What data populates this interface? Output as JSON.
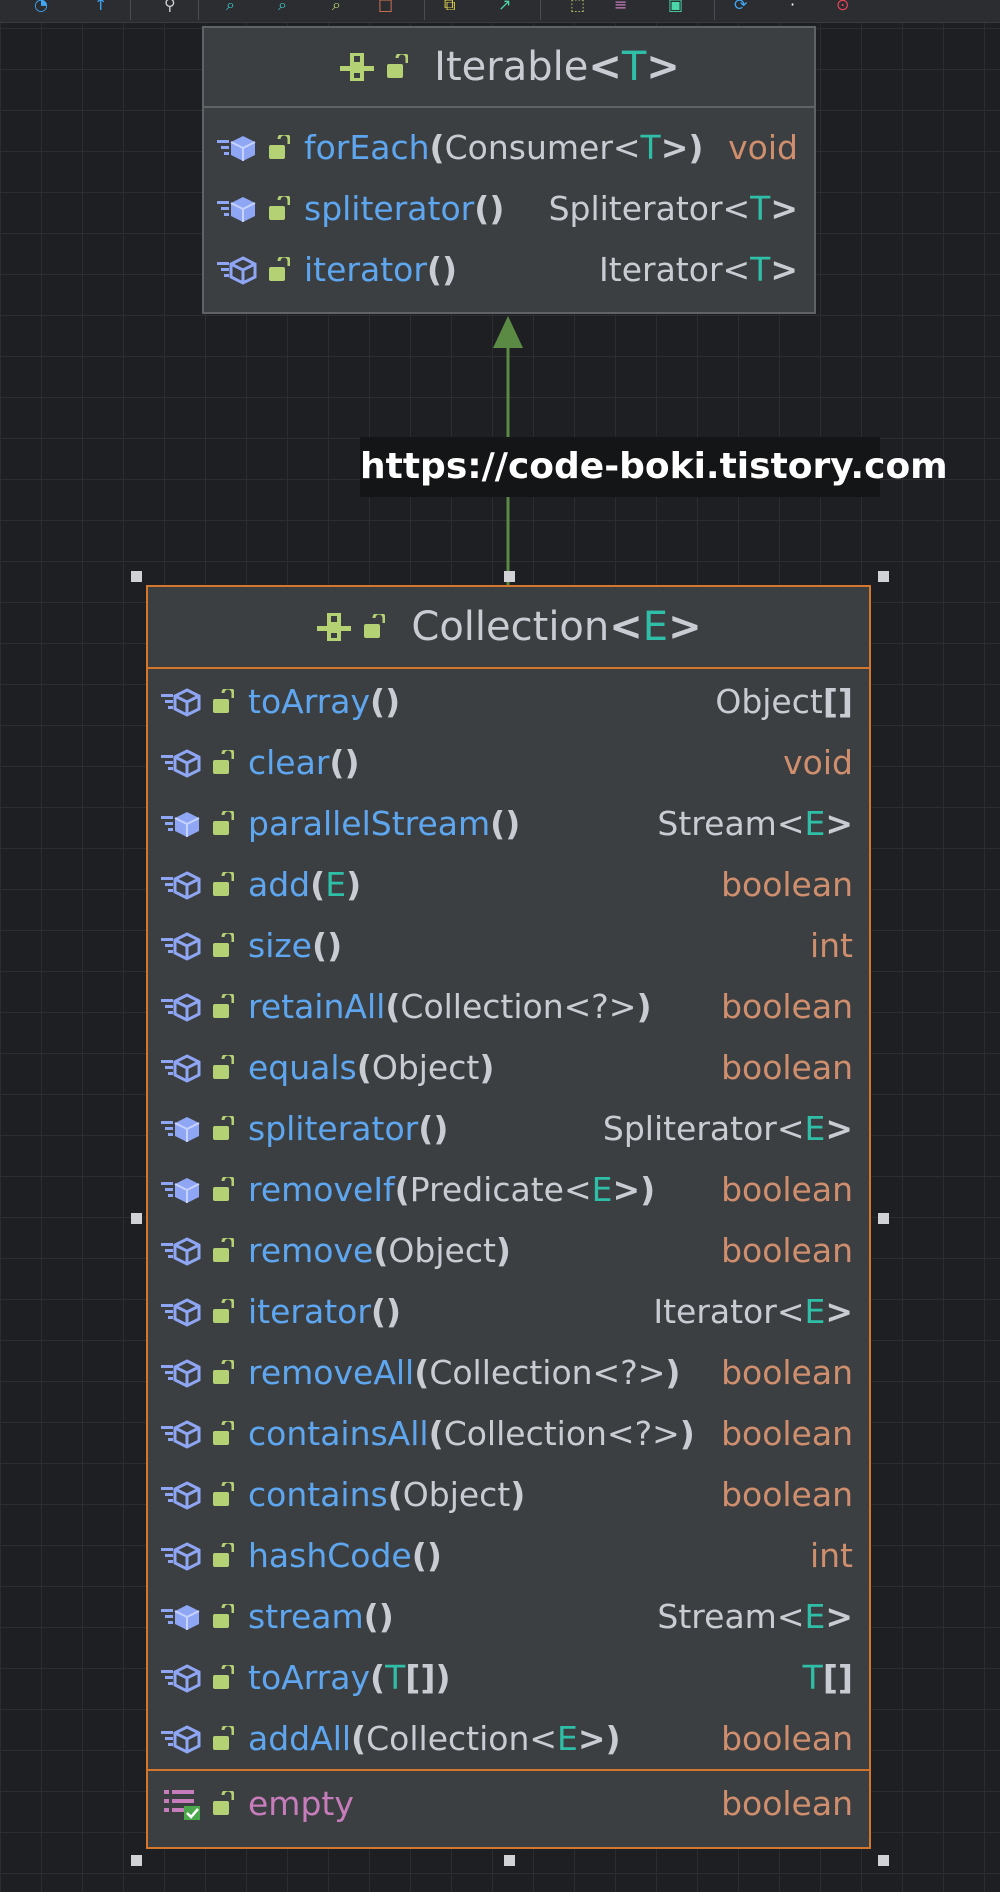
{
  "watermark": "https://code-boki.tistory.com",
  "toolbar": {
    "icons": [
      "refresh-icon",
      "pointer-icon",
      "layout-icon",
      "zoom-in-icon",
      "zoom-out-icon",
      "zoom-fit-icon",
      "export-icon",
      "copy-icon",
      "arrow-icon",
      "class-icon",
      "field-icon",
      "frame-icon",
      "sync-icon",
      "more-icon",
      "info-icon"
    ]
  },
  "colors": {
    "method_name": "#5ea7f0",
    "field_name": "#c77dbb",
    "keyword_type": "#cf8e6d",
    "type_param": "#2fbfa8",
    "plain_text": "#c9cdd3",
    "selection_border": "#d4762c",
    "inherit_arrow": "#5a8a44"
  },
  "iterable": {
    "name": "Iterable",
    "type_param": "T",
    "members": [
      {
        "name": "forEach",
        "params_pre": "Consumer<",
        "params_tp": "T",
        "params_post": ">",
        "ret_type": "",
        "ret_tp": "",
        "ret_post": "",
        "ret_kw": "void",
        "abstract": false
      },
      {
        "name": "spliterator",
        "params_pre": "",
        "params_tp": "",
        "params_post": "",
        "ret_type": "Spliterator<",
        "ret_tp": "T",
        "ret_post": ">",
        "ret_kw": "",
        "abstract": false
      },
      {
        "name": "iterator",
        "params_pre": "",
        "params_tp": "",
        "params_post": "",
        "ret_type": "Iterator<",
        "ret_tp": "T",
        "ret_post": ">",
        "ret_kw": "",
        "abstract": true
      }
    ]
  },
  "collection": {
    "name": "Collection",
    "type_param": "E",
    "members": [
      {
        "name": "toArray",
        "params_pre": "",
        "params_tp": "",
        "params_post": "",
        "ret_type": "Object",
        "ret_tp": "",
        "ret_post": "[]",
        "ret_kw": "",
        "abstract": true
      },
      {
        "name": "clear",
        "params_pre": "",
        "params_tp": "",
        "params_post": "",
        "ret_type": "",
        "ret_tp": "",
        "ret_post": "",
        "ret_kw": "void",
        "abstract": true
      },
      {
        "name": "parallelStream",
        "params_pre": "",
        "params_tp": "",
        "params_post": "",
        "ret_type": "Stream<",
        "ret_tp": "E",
        "ret_post": ">",
        "ret_kw": "",
        "abstract": false
      },
      {
        "name": "add",
        "params_pre": "",
        "params_tp": "E",
        "params_post": "",
        "ret_type": "",
        "ret_tp": "",
        "ret_post": "",
        "ret_kw": "boolean",
        "abstract": true
      },
      {
        "name": "size",
        "params_pre": "",
        "params_tp": "",
        "params_post": "",
        "ret_type": "",
        "ret_tp": "",
        "ret_post": "",
        "ret_kw": "int",
        "abstract": true
      },
      {
        "name": "retainAll",
        "params_pre": "Collection<?>",
        "params_tp": "",
        "params_post": "",
        "ret_type": "",
        "ret_tp": "",
        "ret_post": "",
        "ret_kw": "boolean",
        "abstract": true
      },
      {
        "name": "equals",
        "params_pre": "Object",
        "params_tp": "",
        "params_post": "",
        "ret_type": "",
        "ret_tp": "",
        "ret_post": "",
        "ret_kw": "boolean",
        "abstract": true
      },
      {
        "name": "spliterator",
        "params_pre": "",
        "params_tp": "",
        "params_post": "",
        "ret_type": "Spliterator<",
        "ret_tp": "E",
        "ret_post": ">",
        "ret_kw": "",
        "abstract": false
      },
      {
        "name": "removeIf",
        "params_pre": "Predicate<",
        "params_tp": "E",
        "params_post": ">",
        "ret_type": "",
        "ret_tp": "",
        "ret_post": "",
        "ret_kw": "boolean",
        "abstract": false
      },
      {
        "name": "remove",
        "params_pre": "Object",
        "params_tp": "",
        "params_post": "",
        "ret_type": "",
        "ret_tp": "",
        "ret_post": "",
        "ret_kw": "boolean",
        "abstract": true
      },
      {
        "name": "iterator",
        "params_pre": "",
        "params_tp": "",
        "params_post": "",
        "ret_type": "Iterator<",
        "ret_tp": "E",
        "ret_post": ">",
        "ret_kw": "",
        "abstract": true
      },
      {
        "name": "removeAll",
        "params_pre": "Collection<?>",
        "params_tp": "",
        "params_post": "",
        "ret_type": "",
        "ret_tp": "",
        "ret_post": "",
        "ret_kw": "boolean",
        "abstract": true
      },
      {
        "name": "containsAll",
        "params_pre": "Collection<?>",
        "params_tp": "",
        "params_post": "",
        "ret_type": "",
        "ret_tp": "",
        "ret_post": "",
        "ret_kw": "boolean",
        "abstract": true
      },
      {
        "name": "contains",
        "params_pre": "Object",
        "params_tp": "",
        "params_post": "",
        "ret_type": "",
        "ret_tp": "",
        "ret_post": "",
        "ret_kw": "boolean",
        "abstract": true
      },
      {
        "name": "hashCode",
        "params_pre": "",
        "params_tp": "",
        "params_post": "",
        "ret_type": "",
        "ret_tp": "",
        "ret_post": "",
        "ret_kw": "int",
        "abstract": true
      },
      {
        "name": "stream",
        "params_pre": "",
        "params_tp": "",
        "params_post": "",
        "ret_type": "Stream<",
        "ret_tp": "E",
        "ret_post": ">",
        "ret_kw": "",
        "abstract": false
      },
      {
        "name": "toArray",
        "params_pre": "",
        "params_tp": "T",
        "params_post": "[]",
        "ret_type": "",
        "ret_tp": "T",
        "ret_post": "[]",
        "ret_kw": "",
        "abstract": true
      },
      {
        "name": "addAll",
        "params_pre": "Collection<",
        "params_tp": "E",
        "params_post": ">",
        "ret_type": "",
        "ret_tp": "",
        "ret_post": "",
        "ret_kw": "boolean",
        "abstract": true
      }
    ],
    "fields": [
      {
        "name": "empty",
        "ret_kw": "boolean"
      }
    ]
  }
}
